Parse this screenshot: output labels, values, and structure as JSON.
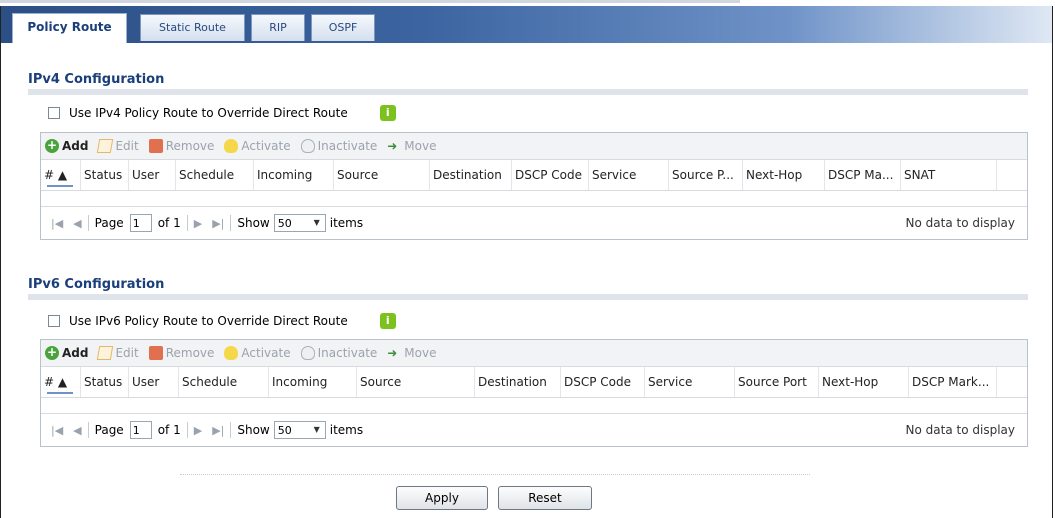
{
  "tabs": [
    "Policy Route",
    "Static Route",
    "RIP",
    "OSPF"
  ],
  "toolbar": {
    "add": "Add",
    "edit": "Edit",
    "remove": "Remove",
    "activate": "Activate",
    "inactivate": "Inactivate",
    "move": "Move"
  },
  "ipv4": {
    "title": "IPv4 Configuration",
    "checkbox_label": "Use IPv4 Policy Route to Override Direct Route",
    "columns": [
      "#",
      "Status",
      "User",
      "Schedule",
      "Incoming",
      "Source",
      "Destination",
      "DSCP Code",
      "Service",
      "Source P...",
      "Next-Hop",
      "DSCP Ma...",
      "SNAT"
    ],
    "pager": {
      "page_label": "Page",
      "page_value": "1",
      "of": "of 1",
      "show": "Show",
      "per_page": "50",
      "items": "items",
      "no_data": "No data to display"
    }
  },
  "ipv6": {
    "title": "IPv6 Configuration",
    "checkbox_label": "Use IPv6 Policy Route to Override Direct Route",
    "columns": [
      "#",
      "Status",
      "User",
      "Schedule",
      "Incoming",
      "Source",
      "Destination",
      "DSCP Code",
      "Service",
      "Source Port",
      "Next-Hop",
      "DSCP Mark..."
    ],
    "pager": {
      "page_label": "Page",
      "page_value": "1",
      "of": "of 1",
      "show": "Show",
      "per_page": "50",
      "items": "items",
      "no_data": "No data to display"
    }
  },
  "buttons": {
    "apply": "Apply",
    "reset": "Reset"
  },
  "icons": {
    "info": "info-icon",
    "add": "add-icon",
    "edit": "edit-icon",
    "remove": "trash-icon",
    "activate": "bulb-icon",
    "inactivate": "bulb-off-icon",
    "move": "move-icon"
  }
}
